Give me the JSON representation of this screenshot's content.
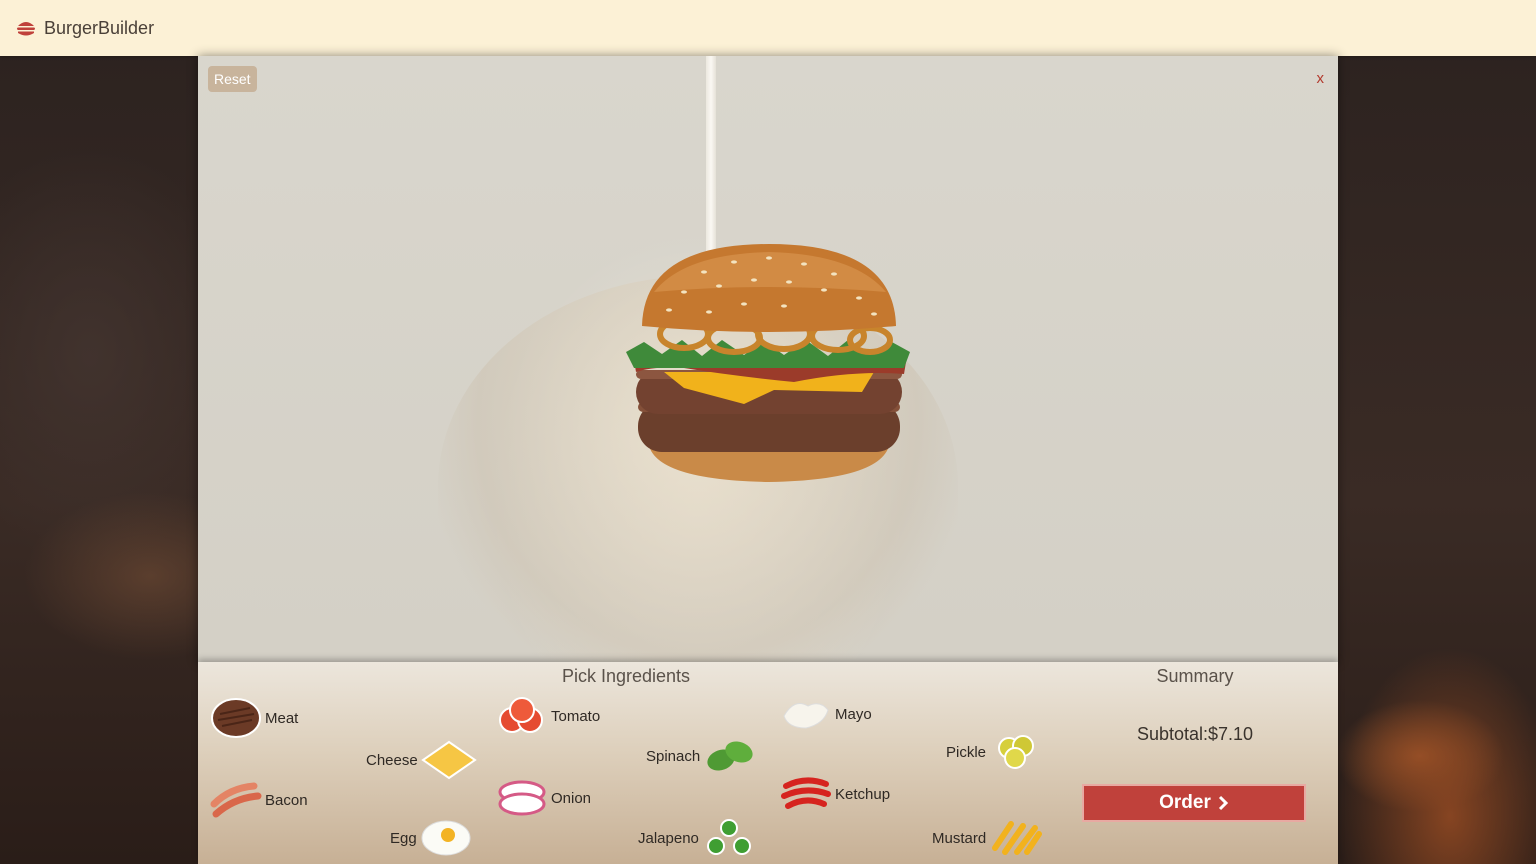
{
  "navbar": {
    "brand": "BurgerBuilder",
    "brand_icon": "burger-icon"
  },
  "builder": {
    "reset_label": "Reset",
    "close_label": "x",
    "burger_layers": [
      "bun-top",
      "onion-rings",
      "lettuce",
      "bacon",
      "cheese",
      "meat",
      "meat",
      "bun-bottom"
    ]
  },
  "tray": {
    "title": "Pick Ingredients",
    "ingredients": [
      {
        "label": "Meat",
        "icon": "meat-icon"
      },
      {
        "label": "Cheese",
        "icon": "cheese-icon"
      },
      {
        "label": "Bacon",
        "icon": "bacon-icon"
      },
      {
        "label": "Egg",
        "icon": "egg-icon"
      },
      {
        "label": "Tomato",
        "icon": "tomato-icon"
      },
      {
        "label": "Spinach",
        "icon": "spinach-icon"
      },
      {
        "label": "Onion",
        "icon": "onion-icon"
      },
      {
        "label": "Jalapeno",
        "icon": "jalapeno-icon"
      },
      {
        "label": "Mayo",
        "icon": "mayo-icon"
      },
      {
        "label": "Pickle",
        "icon": "pickle-icon"
      },
      {
        "label": "Ketchup",
        "icon": "ketchup-icon"
      },
      {
        "label": "Mustard",
        "icon": "mustard-icon"
      }
    ]
  },
  "summary": {
    "title": "Summary",
    "subtotal": "Subtotal:$7.10",
    "order_label": "Order"
  },
  "colors": {
    "navbar_bg": "#fcf1d6",
    "accent_red": "#c0413b",
    "reset_bg": "#c8b49c",
    "close_red": "#b33a2d"
  }
}
